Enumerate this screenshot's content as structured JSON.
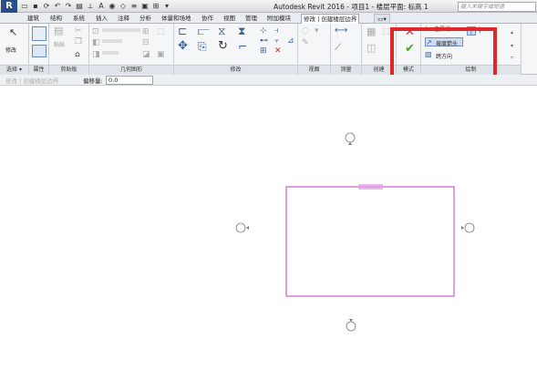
{
  "app": {
    "logo": "R",
    "title": "Autodesk Revit 2016 -    项目1 - 楼层平面: 标高 1",
    "search_placeholder": "键入关键字或短语"
  },
  "tabs": [
    "建筑",
    "结构",
    "系统",
    "插入",
    "注释",
    "分析",
    "体量和场地",
    "协作",
    "视图",
    "管理",
    "附加模块",
    "修改 | 创建楼层边界"
  ],
  "ribbon": {
    "panels": [
      "选择 ▾",
      "属性",
      "剪贴板",
      "几何图形",
      "修改",
      "视图",
      "测量",
      "创建",
      "模式",
      "绘制"
    ],
    "modify_label": "修改",
    "paste_label": "粘贴",
    "draw_items": [
      "边界线",
      "坡度箭头",
      "跨方向"
    ]
  },
  "options_bar": {
    "hint": "修改 | 创建楼层边界",
    "offset_label": "偏移量:",
    "offset_value": "0.0"
  },
  "colors": {
    "accent": "#e0282c",
    "sketch_line": "#c040c0",
    "cancel": "#d9262b",
    "finish": "#4aa02c"
  }
}
